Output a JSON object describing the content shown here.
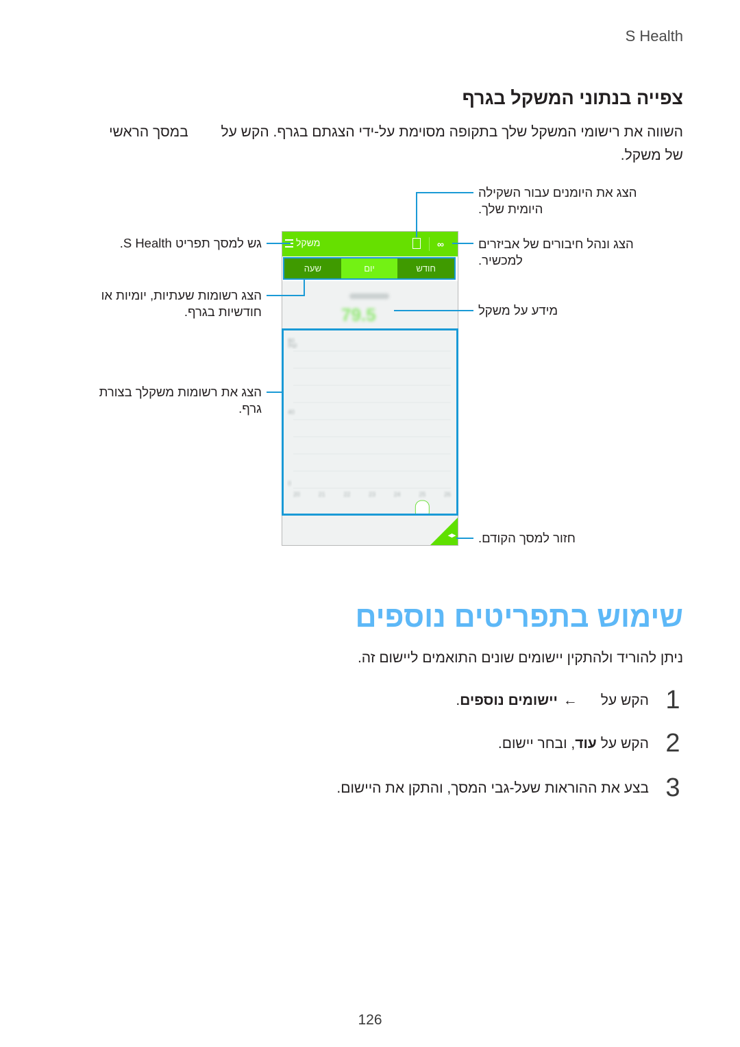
{
  "header": {
    "title": "S Health"
  },
  "section": {
    "title": "צפייה בנתוני המשקל בגרף",
    "intro_part1": "השווה את רישומי המשקל שלך בתקופה מסוימת על-ידי הצגתם בגרף. הקש על",
    "intro_part2": "במסך הראשי",
    "intro_line2": "של משקל."
  },
  "phone": {
    "appbar_title": "משקל",
    "icons": {
      "menu": "menu-icon",
      "records": "document-chart-icon",
      "connect": "link-icon",
      "back": "back-icon"
    },
    "tabs": [
      {
        "label": "שעה",
        "active": false
      },
      {
        "label": "יום",
        "active": true
      },
      {
        "label": "חודש",
        "active": false
      }
    ],
    "summary_value": "79.5",
    "accent_color": "#66e000"
  },
  "callouts": {
    "right": [
      {
        "lines": [
          "הצג את היומנים עבור השקילה",
          "היומית שלך."
        ]
      },
      {
        "lines": [
          "הצג ונהל חיבורים של אביזרים",
          "למכשיר."
        ]
      },
      {
        "lines": [
          "מידע על משקל"
        ]
      },
      {
        "lines": [
          "חזור למסך הקודם."
        ]
      }
    ],
    "left": [
      {
        "lines": [
          "גש למסך תפריט S Health."
        ]
      },
      {
        "lines": [
          "הצג רשומות שעתיות, יומיות או",
          "חודשיות בגרף."
        ]
      },
      {
        "lines": [
          "הצג את רשומות משקלך בצורת",
          "גרף."
        ]
      }
    ]
  },
  "chart_data": {
    "type": "line",
    "title": "",
    "xlabel": "",
    "ylabel": "(kg)",
    "categories": [
      "20",
      "21",
      "22",
      "23",
      "24",
      "25",
      "26"
    ],
    "y_ticks": [
      "80",
      "40",
      "0"
    ],
    "ylim": [
      0,
      80
    ],
    "selected_category": "25",
    "note": "chart values blurred in source; not legible"
  },
  "more_apps": {
    "title": "שימוש בתפריטים נוספים",
    "body": "ניתן להוריד ולהתקין יישומים שונים התואמים ליישום זה.",
    "steps": [
      {
        "num": "1",
        "pre": "הקש על",
        "arrow": "←",
        "bold": "יישומים נוספים",
        "post": "."
      },
      {
        "num": "2",
        "pre": "הקש על",
        "bold": "עוד",
        "post": ", ובחר יישום."
      },
      {
        "num": "3",
        "pre": "בצע את ההוראות שעל-גבי המסך, והתקן את היישום.",
        "bold": "",
        "post": ""
      }
    ]
  },
  "footer": {
    "page_number": "126"
  }
}
